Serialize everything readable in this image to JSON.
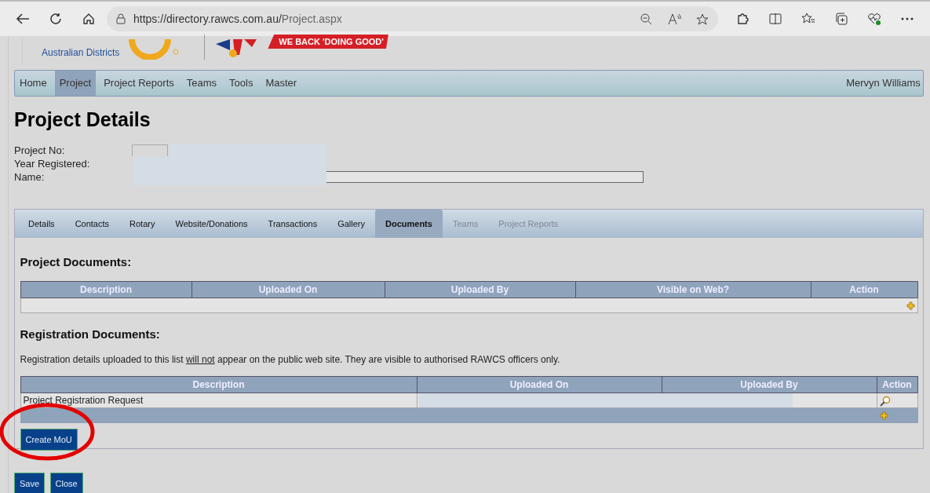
{
  "browser": {
    "url_host": "https://directory.rawcs.com.au/",
    "url_path": "Project.aspx"
  },
  "header": {
    "org_subtitle": "Australian Districts",
    "tagline": "WE BACK 'DOING GOOD'"
  },
  "menu": [
    {
      "label": "Home",
      "selected": false
    },
    {
      "label": "Project",
      "selected": true
    },
    {
      "label": "Project Reports",
      "selected": false
    },
    {
      "label": "Teams",
      "selected": false
    },
    {
      "label": "Tools",
      "selected": false
    },
    {
      "label": "Master",
      "selected": false
    }
  ],
  "user_name": "Mervyn Williams",
  "page_title": "Project Details",
  "fields": [
    {
      "label": "Project No:",
      "kind": "short"
    },
    {
      "label": "Year Registered:",
      "kind": "none"
    },
    {
      "label": "Name:",
      "kind": "long"
    }
  ],
  "tabs": [
    {
      "label": "Details",
      "selected": false,
      "disabled": false
    },
    {
      "label": "Contacts",
      "selected": false,
      "disabled": false
    },
    {
      "label": "Rotary",
      "selected": false,
      "disabled": false
    },
    {
      "label": "Website/Donations",
      "selected": false,
      "disabled": false
    },
    {
      "label": "Transactions",
      "selected": false,
      "disabled": false
    },
    {
      "label": "Gallery",
      "selected": false,
      "disabled": false
    },
    {
      "label": "Documents",
      "selected": true,
      "disabled": false
    },
    {
      "label": "Teams",
      "selected": false,
      "disabled": true
    },
    {
      "label": "Project Reports",
      "selected": false,
      "disabled": true
    }
  ],
  "project_documents": {
    "heading": "Project Documents:",
    "columns": [
      "Description",
      "Uploaded On",
      "Uploaded By",
      "Visible on Web?",
      "Action"
    ]
  },
  "registration_documents": {
    "heading": "Registration Documents:",
    "note_parts": [
      "Registration details uploaded to this list ",
      "will not",
      " appear on the public web site. They are visible to authorised RAWCS officers only."
    ],
    "columns": [
      "Description",
      "Uploaded On",
      "Uploaded By",
      "Action"
    ],
    "rows": [
      {
        "description": "Project Registration Request"
      }
    ]
  },
  "create_button": "Create MoU",
  "buttons": [
    "Save",
    "Close"
  ]
}
